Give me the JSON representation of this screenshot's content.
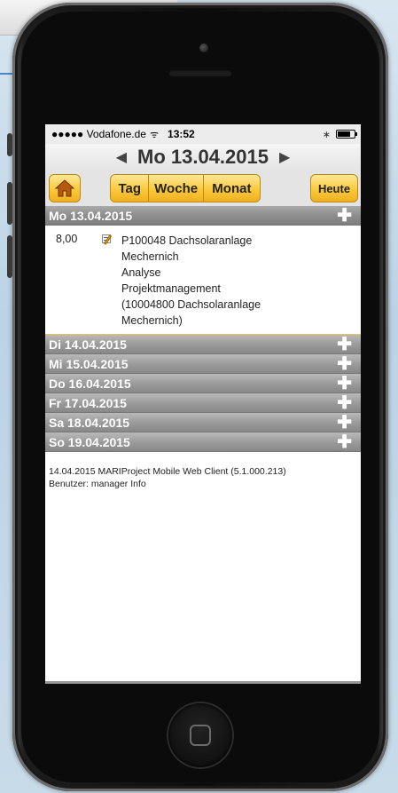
{
  "status_bar": {
    "carrier": "●●●●● Vodafone.de",
    "wifi_glyph": "ᯤ",
    "time": "13:52",
    "bluetooth_glyph": "∗",
    "battery_level": 0.8
  },
  "date_nav": {
    "prev_glyph": "◀",
    "current_date": "Mo 13.04.2015",
    "next_glyph": "▶"
  },
  "toolbar": {
    "home_glyph": "🏠",
    "tag_label": "Tag",
    "woche_label": "Woche",
    "monat_label": "Monat",
    "today_label": "Heute"
  },
  "days": [
    {
      "label": "Mo 13.04.2015"
    },
    {
      "label": "Di 14.04.2015"
    },
    {
      "label": "Mi 15.04.2015"
    },
    {
      "label": "Do 16.04.2015"
    },
    {
      "label": "Fr 17.04.2015"
    },
    {
      "label": "Sa 18.04.2015"
    },
    {
      "label": "So 19.04.2015"
    }
  ],
  "plus_glyph": "✚",
  "entry": {
    "hours": "8,00",
    "lines": [
      "P100048 Dachsolaranlage",
      "Mechernich",
      "Analyse",
      "Projektmanagement",
      "(10004800 Dachsolaranlage",
      "Mechernich)"
    ]
  },
  "footer": {
    "line1": "14.04.2015 MARIProject Mobile Web Client (5.1.000.213)",
    "line2": "Benutzer: manager Info"
  },
  "colors": {
    "button_yellow": "#fbc93a",
    "header_gray": "#9c9c9c"
  }
}
